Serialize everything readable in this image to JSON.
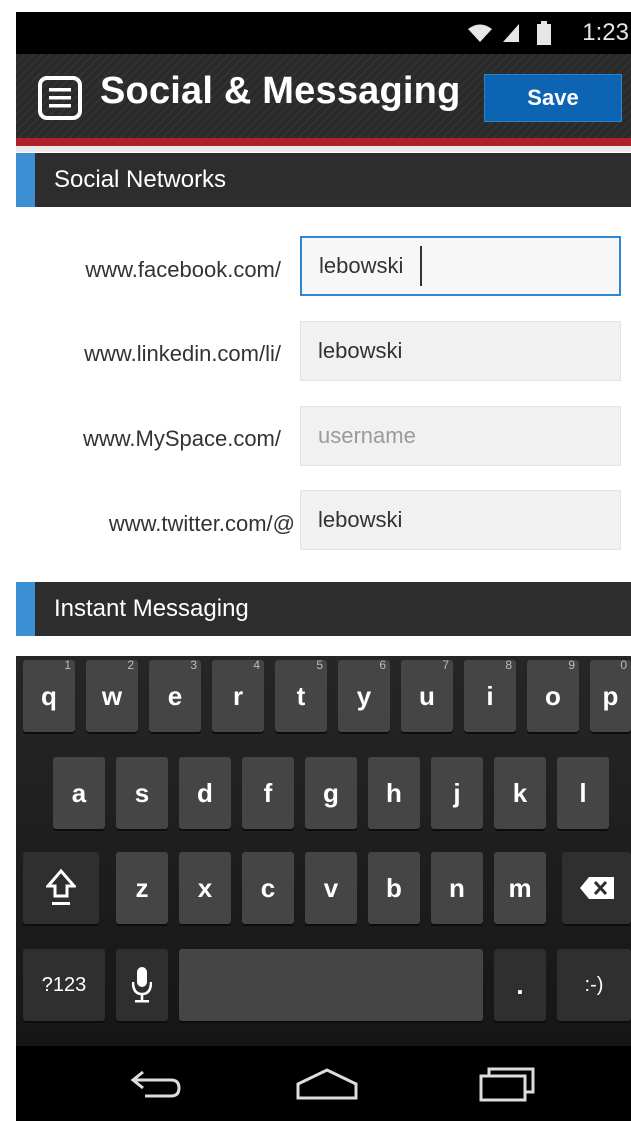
{
  "status_bar": {
    "time": "1:23",
    "icons": [
      "wifi-icon",
      "signal-icon",
      "battery-icon"
    ]
  },
  "header": {
    "title": "Social & Messaging",
    "save_label": "Save",
    "menu_icon": "menu-icon"
  },
  "sections": {
    "social_networks": "Social Networks",
    "instant_messaging": "Instant Messaging"
  },
  "social_fields": [
    {
      "label": "www.facebook.com/",
      "value": "lebowski",
      "placeholder": ""
    },
    {
      "label": "www.linkedin.com/li/",
      "value": "lebowski",
      "placeholder": ""
    },
    {
      "label": "www.MySpace.com/",
      "value": "",
      "placeholder": "username"
    },
    {
      "label": "www.twitter.com/@",
      "value": "lebowski",
      "placeholder": ""
    }
  ],
  "keyboard": {
    "row1": [
      {
        "key": "q",
        "hint": "1"
      },
      {
        "key": "w",
        "hint": "2"
      },
      {
        "key": "e",
        "hint": "3"
      },
      {
        "key": "r",
        "hint": "4"
      },
      {
        "key": "t",
        "hint": "5"
      },
      {
        "key": "y",
        "hint": "6"
      },
      {
        "key": "u",
        "hint": "7"
      },
      {
        "key": "i",
        "hint": "8"
      },
      {
        "key": "o",
        "hint": "9"
      },
      {
        "key": "p",
        "hint": "0"
      }
    ],
    "row2": [
      "a",
      "s",
      "d",
      "f",
      "g",
      "h",
      "j",
      "k",
      "l"
    ],
    "row3": [
      "z",
      "x",
      "c",
      "v",
      "b",
      "n",
      "m"
    ],
    "symbols_label": "?123",
    "period_label": ".",
    "emoticon_label": ":-)",
    "shift_icon": "shift-icon",
    "backspace_icon": "backspace-icon",
    "mic_icon": "microphone-icon"
  },
  "navigation": [
    "back-icon",
    "home-icon",
    "recent-apps-icon"
  ],
  "colors": {
    "accent_blue": "#3b8fd2",
    "save_blue": "#0c64b2",
    "header_red": "#b0202a",
    "section_bg": "#2d2d2d"
  }
}
